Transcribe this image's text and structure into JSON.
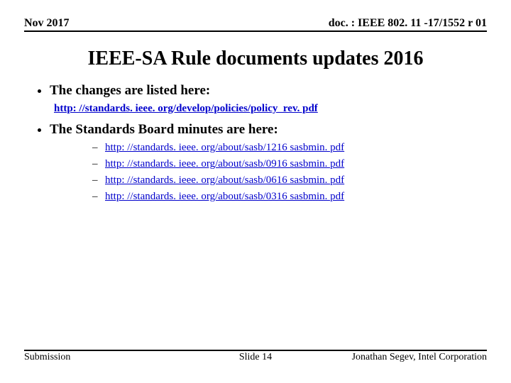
{
  "header": {
    "left": "Nov 2017",
    "right": "doc. : IEEE 802. 11 -17/1552 r 01"
  },
  "title": "IEEE-SA Rule documents updates 2016",
  "bullet1": {
    "text": "The changes are listed here:",
    "link": "http: //standards. ieee. org/develop/policies/policy_rev. pdf"
  },
  "bullet2": {
    "text": "The Standards Board minutes are here:",
    "links": [
      "http: //standards. ieee. org/about/sasb/1216 sasbmin. pdf",
      "http: //standards. ieee. org/about/sasb/0916 sasbmin. pdf",
      "http: //standards. ieee. org/about/sasb/0616 sasbmin. pdf",
      "http: //standards. ieee. org/about/sasb/0316 sasbmin. pdf"
    ]
  },
  "footer": {
    "left": "Submission",
    "center": "Slide 14",
    "right": "Jonathan Segev, Intel Corporation"
  }
}
